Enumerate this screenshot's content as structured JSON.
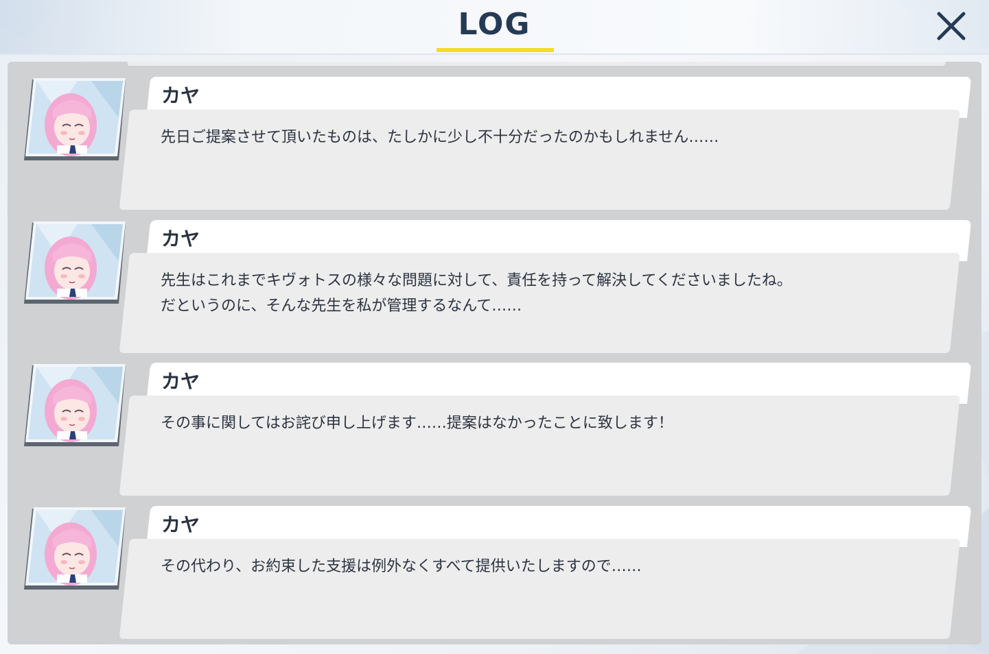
{
  "header": {
    "title": "LOG",
    "close_icon": "close-icon",
    "accent_color": "#f4dc2c",
    "title_color": "#253a55"
  },
  "entries": [
    {
      "speaker": "カヤ",
      "avatar_icon": "character-portrait",
      "text": "先日ご提案させて頂いたものは、たしかに少し不十分だったのかもしれません……"
    },
    {
      "speaker": "カヤ",
      "avatar_icon": "character-portrait",
      "text": "先生はこれまでキヴォトスの様々な問題に対して、責任を持って解決してくださいましたね。\nだというのに、そんな先生を私が管理するなんて……"
    },
    {
      "speaker": "カヤ",
      "avatar_icon": "character-portrait",
      "text": "その事に関してはお詫び申し上げます……提案はなかったことに致します！"
    },
    {
      "speaker": "カヤ",
      "avatar_icon": "character-portrait",
      "text": "その代わり、お約束した支援は例外なくすべて提供いたしますので……"
    }
  ]
}
